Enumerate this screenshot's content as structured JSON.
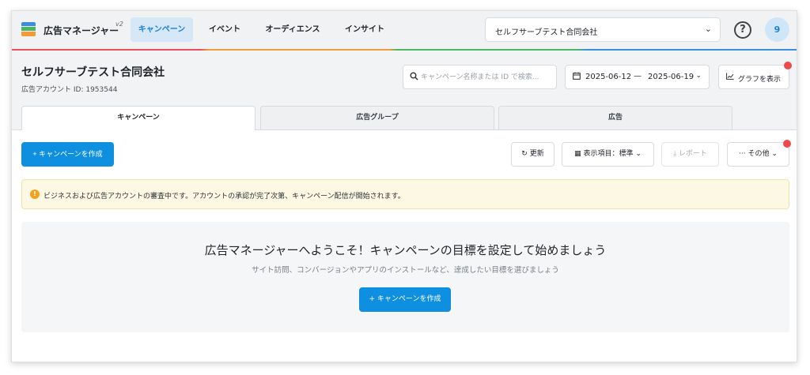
{
  "topbar": {
    "brand": "広告マネージャー",
    "brand_version": "v2",
    "nav": [
      "キャンペーン",
      "イベント",
      "オーディエンス",
      "インサイト"
    ],
    "account_selector": "セルフサーブテスト合同会社",
    "help_label": "?",
    "avatar_label": "9"
  },
  "header": {
    "company": "セルフサーブテスト合同会社",
    "account_id": "広告アカウント ID: 1953544",
    "search_placeholder": "キャンペーン名称または ID で検索...",
    "date_start": "2025-06-12",
    "date_separator": "—",
    "date_end": "2025-06-19",
    "graph_button": "グラフを表示"
  },
  "tabs": [
    "キャンペーン",
    "広告グループ",
    "広告"
  ],
  "toolbar": {
    "create": "+ キャンペーンを作成",
    "refresh": "更新",
    "columns": "表示項目：標準",
    "report": "レポート",
    "more": "その他"
  },
  "notice": "ビジネスおよび広告アカウントの審査中です。アカウントの承認が完了次第、キャンペーン配信が開始されます。",
  "welcome": {
    "title": "広告マネージャーへようこそ！キャンペーンの目標を設定して始めましょう",
    "subtitle": "サイト訪問、コンバージョンやアプリのインストールなど、達成したい目標を選びましょう",
    "cta": "+ キャンペーンを作成"
  },
  "colors": {
    "accent": "#0e8fe0",
    "nav_active_bg": "#d6e8f7",
    "notice_bg": "#fdf8e3",
    "badge_dot": "#ee4a4a"
  }
}
